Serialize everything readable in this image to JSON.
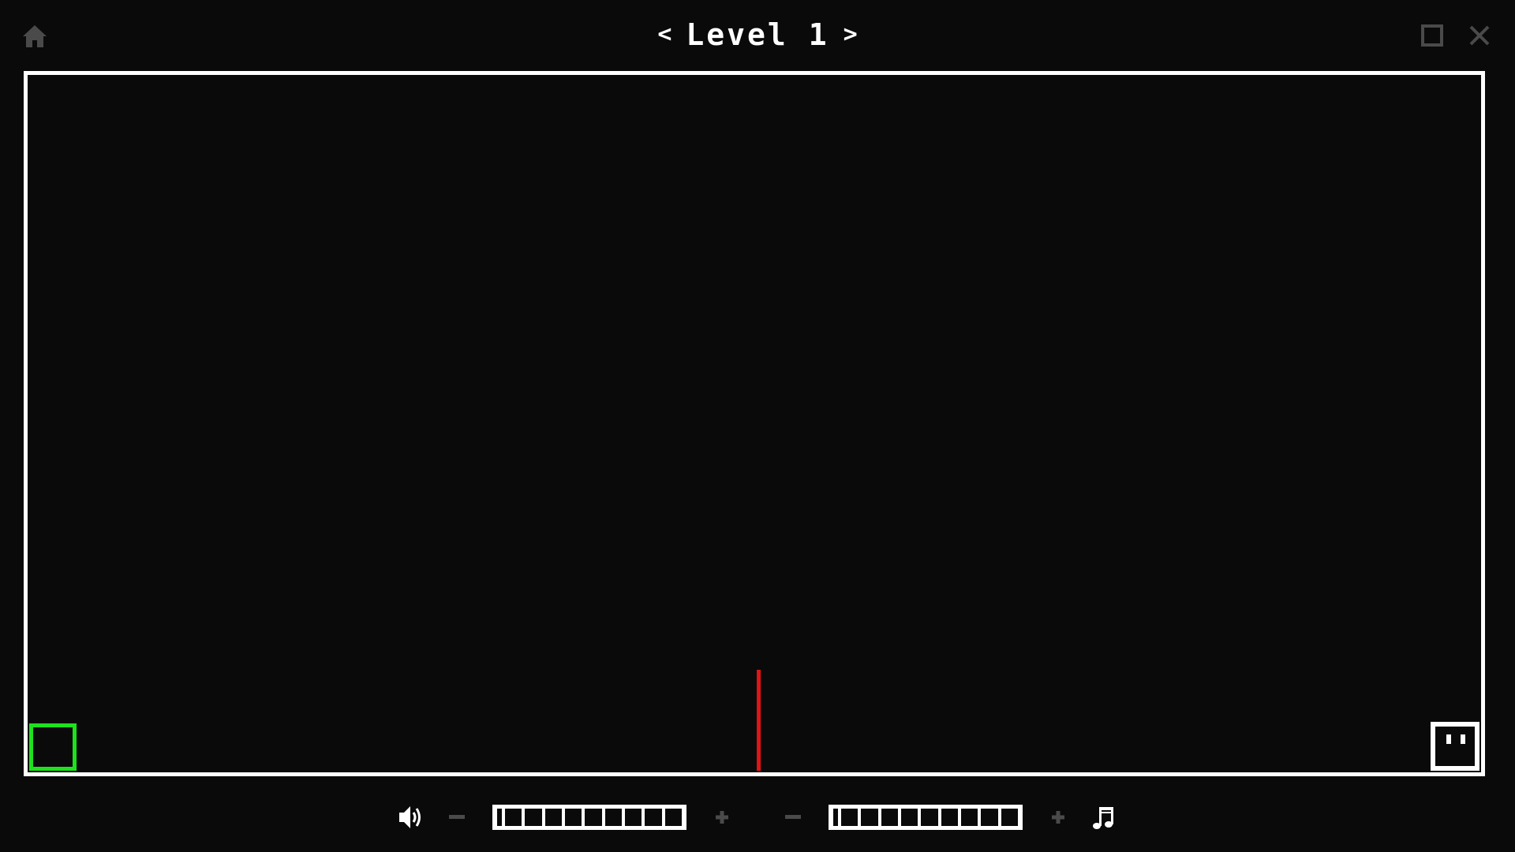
{
  "header": {
    "level_title": "Level 1",
    "prev_label": "<",
    "next_label": ">"
  },
  "icons": {
    "home": "home-icon",
    "fullscreen": "fullscreen-icon",
    "close": "close-icon",
    "sound": "speaker-icon",
    "music": "music-note-icon"
  },
  "audio": {
    "sound_volume_segments": 10,
    "sound_volume_level": 0,
    "music_volume_segments": 10,
    "music_volume_level": 0,
    "minus_label": "−",
    "plus_label": "+"
  },
  "colors": {
    "background": "#0a0a0a",
    "frame": "#ffffff",
    "player": "#1ee11e",
    "hazard": "#e01414",
    "goal": "#ffffff",
    "dim_icon": "#4a4a4a"
  }
}
